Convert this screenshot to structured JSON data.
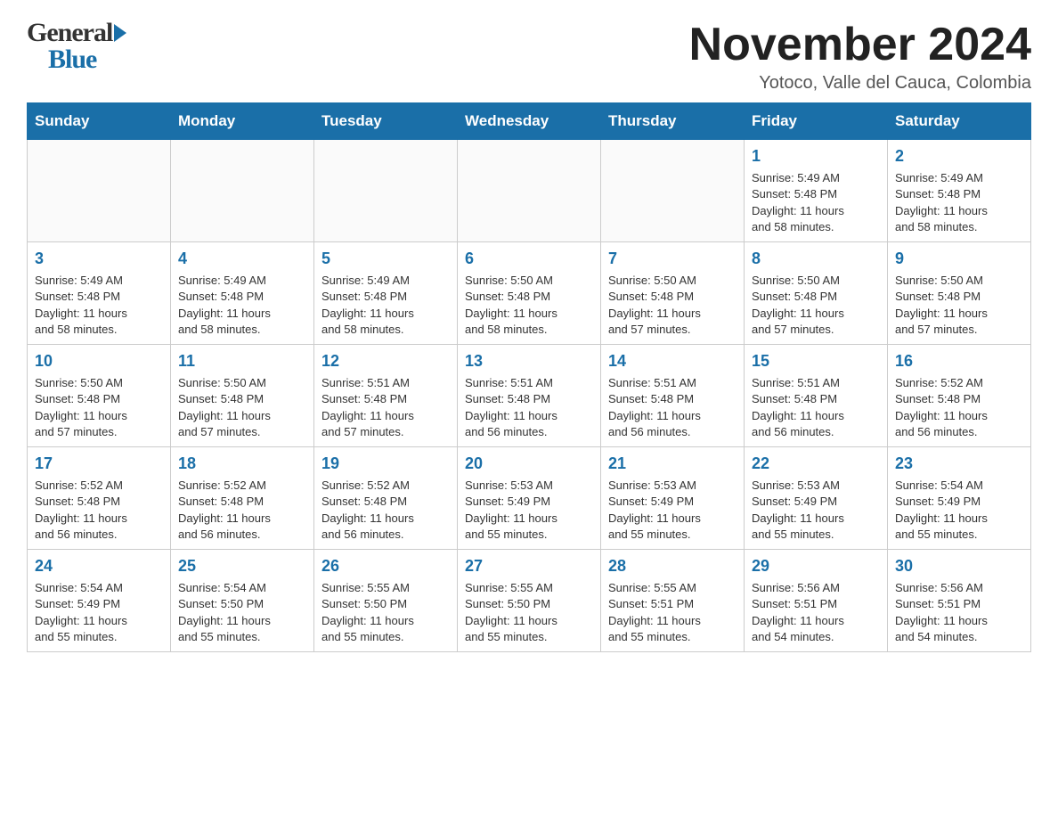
{
  "header": {
    "logo_general": "General",
    "logo_blue": "Blue",
    "month_title": "November 2024",
    "location": "Yotoco, Valle del Cauca, Colombia"
  },
  "days_of_week": [
    "Sunday",
    "Monday",
    "Tuesday",
    "Wednesday",
    "Thursday",
    "Friday",
    "Saturday"
  ],
  "weeks": [
    [
      {
        "day": "",
        "info": ""
      },
      {
        "day": "",
        "info": ""
      },
      {
        "day": "",
        "info": ""
      },
      {
        "day": "",
        "info": ""
      },
      {
        "day": "",
        "info": ""
      },
      {
        "day": "1",
        "info": "Sunrise: 5:49 AM\nSunset: 5:48 PM\nDaylight: 11 hours\nand 58 minutes."
      },
      {
        "day": "2",
        "info": "Sunrise: 5:49 AM\nSunset: 5:48 PM\nDaylight: 11 hours\nand 58 minutes."
      }
    ],
    [
      {
        "day": "3",
        "info": "Sunrise: 5:49 AM\nSunset: 5:48 PM\nDaylight: 11 hours\nand 58 minutes."
      },
      {
        "day": "4",
        "info": "Sunrise: 5:49 AM\nSunset: 5:48 PM\nDaylight: 11 hours\nand 58 minutes."
      },
      {
        "day": "5",
        "info": "Sunrise: 5:49 AM\nSunset: 5:48 PM\nDaylight: 11 hours\nand 58 minutes."
      },
      {
        "day": "6",
        "info": "Sunrise: 5:50 AM\nSunset: 5:48 PM\nDaylight: 11 hours\nand 58 minutes."
      },
      {
        "day": "7",
        "info": "Sunrise: 5:50 AM\nSunset: 5:48 PM\nDaylight: 11 hours\nand 57 minutes."
      },
      {
        "day": "8",
        "info": "Sunrise: 5:50 AM\nSunset: 5:48 PM\nDaylight: 11 hours\nand 57 minutes."
      },
      {
        "day": "9",
        "info": "Sunrise: 5:50 AM\nSunset: 5:48 PM\nDaylight: 11 hours\nand 57 minutes."
      }
    ],
    [
      {
        "day": "10",
        "info": "Sunrise: 5:50 AM\nSunset: 5:48 PM\nDaylight: 11 hours\nand 57 minutes."
      },
      {
        "day": "11",
        "info": "Sunrise: 5:50 AM\nSunset: 5:48 PM\nDaylight: 11 hours\nand 57 minutes."
      },
      {
        "day": "12",
        "info": "Sunrise: 5:51 AM\nSunset: 5:48 PM\nDaylight: 11 hours\nand 57 minutes."
      },
      {
        "day": "13",
        "info": "Sunrise: 5:51 AM\nSunset: 5:48 PM\nDaylight: 11 hours\nand 56 minutes."
      },
      {
        "day": "14",
        "info": "Sunrise: 5:51 AM\nSunset: 5:48 PM\nDaylight: 11 hours\nand 56 minutes."
      },
      {
        "day": "15",
        "info": "Sunrise: 5:51 AM\nSunset: 5:48 PM\nDaylight: 11 hours\nand 56 minutes."
      },
      {
        "day": "16",
        "info": "Sunrise: 5:52 AM\nSunset: 5:48 PM\nDaylight: 11 hours\nand 56 minutes."
      }
    ],
    [
      {
        "day": "17",
        "info": "Sunrise: 5:52 AM\nSunset: 5:48 PM\nDaylight: 11 hours\nand 56 minutes."
      },
      {
        "day": "18",
        "info": "Sunrise: 5:52 AM\nSunset: 5:48 PM\nDaylight: 11 hours\nand 56 minutes."
      },
      {
        "day": "19",
        "info": "Sunrise: 5:52 AM\nSunset: 5:48 PM\nDaylight: 11 hours\nand 56 minutes."
      },
      {
        "day": "20",
        "info": "Sunrise: 5:53 AM\nSunset: 5:49 PM\nDaylight: 11 hours\nand 55 minutes."
      },
      {
        "day": "21",
        "info": "Sunrise: 5:53 AM\nSunset: 5:49 PM\nDaylight: 11 hours\nand 55 minutes."
      },
      {
        "day": "22",
        "info": "Sunrise: 5:53 AM\nSunset: 5:49 PM\nDaylight: 11 hours\nand 55 minutes."
      },
      {
        "day": "23",
        "info": "Sunrise: 5:54 AM\nSunset: 5:49 PM\nDaylight: 11 hours\nand 55 minutes."
      }
    ],
    [
      {
        "day": "24",
        "info": "Sunrise: 5:54 AM\nSunset: 5:49 PM\nDaylight: 11 hours\nand 55 minutes."
      },
      {
        "day": "25",
        "info": "Sunrise: 5:54 AM\nSunset: 5:50 PM\nDaylight: 11 hours\nand 55 minutes."
      },
      {
        "day": "26",
        "info": "Sunrise: 5:55 AM\nSunset: 5:50 PM\nDaylight: 11 hours\nand 55 minutes."
      },
      {
        "day": "27",
        "info": "Sunrise: 5:55 AM\nSunset: 5:50 PM\nDaylight: 11 hours\nand 55 minutes."
      },
      {
        "day": "28",
        "info": "Sunrise: 5:55 AM\nSunset: 5:51 PM\nDaylight: 11 hours\nand 55 minutes."
      },
      {
        "day": "29",
        "info": "Sunrise: 5:56 AM\nSunset: 5:51 PM\nDaylight: 11 hours\nand 54 minutes."
      },
      {
        "day": "30",
        "info": "Sunrise: 5:56 AM\nSunset: 5:51 PM\nDaylight: 11 hours\nand 54 minutes."
      }
    ]
  ]
}
